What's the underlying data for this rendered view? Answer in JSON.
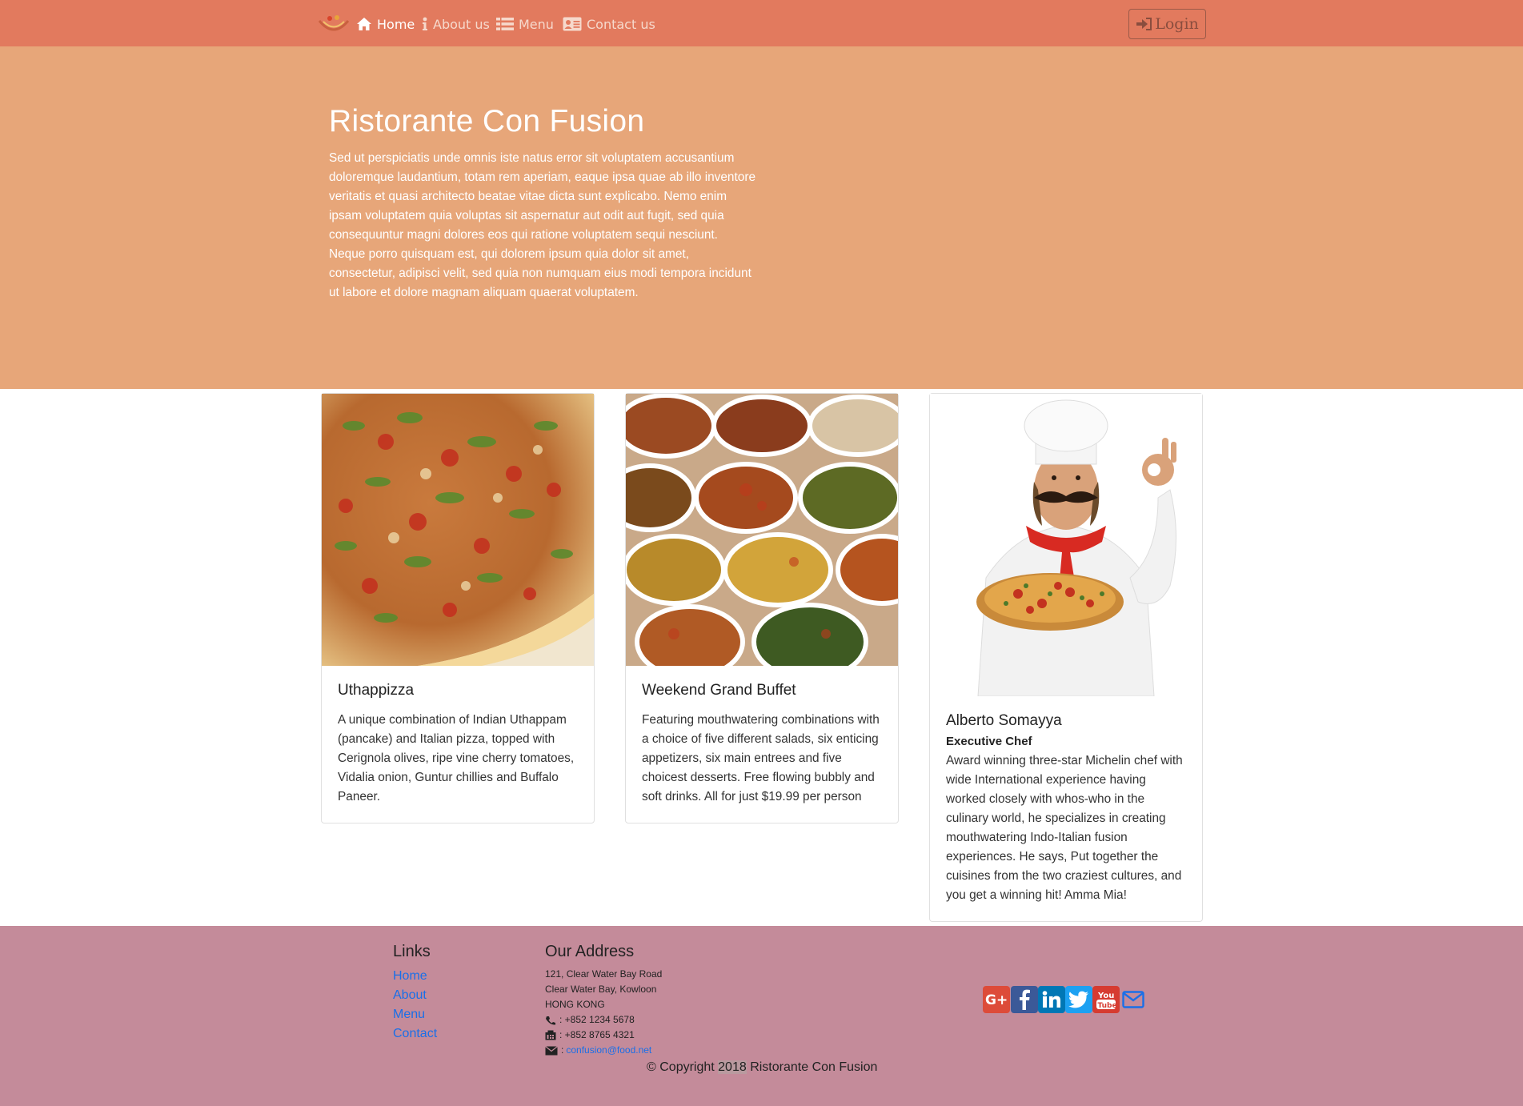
{
  "nav": {
    "items": [
      {
        "label": "Home",
        "icon": "home-icon",
        "active": true
      },
      {
        "label": "About us",
        "icon": "info-icon",
        "active": false
      },
      {
        "label": "Menu",
        "icon": "list-icon",
        "active": false
      },
      {
        "label": "Contact us",
        "icon": "address-card-icon",
        "active": false
      }
    ],
    "login_label": "Login"
  },
  "hero": {
    "title": "Ristorante Con Fusion",
    "text": "Sed ut perspiciatis unde omnis iste natus error sit voluptatem accusantium doloremque laudantium, totam rem aperiam, eaque ipsa quae ab illo inventore veritatis et quasi architecto beatae vitae dicta sunt explicabo. Nemo enim ipsam voluptatem quia voluptas sit aspernatur aut odit aut fugit, sed quia consequuntur magni dolores eos qui ratione voluptatem sequi nesciunt. Neque porro quisquam est, qui dolorem ipsum quia dolor sit amet, consectetur, adipisci velit, sed quia non numquam eius modi tempora incidunt ut labore et dolore magnam aliquam quaerat voluptatem."
  },
  "cards": [
    {
      "title": "Uthappizza",
      "text": "A unique combination of Indian Uthappam (pancake) and Italian pizza, topped with Cerignola olives, ripe vine cherry tomatoes, Vidalia onion, Guntur chillies and Buffalo Paneer."
    },
    {
      "title": "Weekend Grand Buffet",
      "text": "Featuring mouthwatering combinations with a choice of five different salads, six enticing appetizers, six main entrees and five choicest desserts. Free flowing bubbly and soft drinks. All for just $19.99 per person"
    },
    {
      "title": "Alberto Somayya",
      "subtitle": "Executive Chef",
      "text": "Award winning three-star Michelin chef with wide International experience having worked closely with whos-who in the culinary world, he specializes in creating mouthwatering Indo-Italian fusion experiences. He says, Put together the cuisines from the two craziest cultures, and you get a winning hit! Amma Mia!"
    }
  ],
  "footer": {
    "links_heading": "Links",
    "links": [
      "Home",
      "About",
      "Menu",
      "Contact"
    ],
    "address_heading": "Our Address",
    "address": [
      "121, Clear Water Bay Road",
      "Clear Water Bay, Kowloon",
      "HONG KONG"
    ],
    "phone": ": +852 1234 5678",
    "fax": ": +852 8765 4321",
    "email_prefix": ":",
    "email": "confusion@food.net",
    "copyright_prefix": "© Copyright ",
    "copyright_year": "2018",
    "copyright_suffix": " Ristorante Con Fusion",
    "social": [
      {
        "name": "google-plus",
        "color": "#dd4b39"
      },
      {
        "name": "facebook",
        "color": "#3b5998"
      },
      {
        "name": "linkedin",
        "color": "#0077b5"
      },
      {
        "name": "twitter",
        "color": "#1da1f2"
      },
      {
        "name": "youtube",
        "color": "#d63b30"
      },
      {
        "name": "mail",
        "color": "#1a6fe8"
      }
    ]
  },
  "colors": {
    "navbar": "#e27a5e",
    "jumbotron": "#e7a679",
    "footer": "#c48b9a",
    "link": "#1a6fe8"
  }
}
